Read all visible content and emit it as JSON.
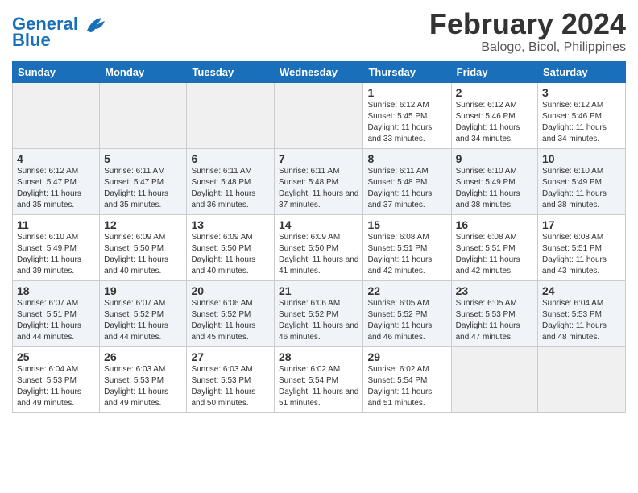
{
  "header": {
    "logo_line1": "General",
    "logo_line2": "Blue",
    "month_title": "February 2024",
    "location": "Balogo, Bicol, Philippines"
  },
  "days_of_week": [
    "Sunday",
    "Monday",
    "Tuesday",
    "Wednesday",
    "Thursday",
    "Friday",
    "Saturday"
  ],
  "weeks": [
    [
      {
        "day": "",
        "sunrise": "",
        "sunset": "",
        "daylight": ""
      },
      {
        "day": "",
        "sunrise": "",
        "sunset": "",
        "daylight": ""
      },
      {
        "day": "",
        "sunrise": "",
        "sunset": "",
        "daylight": ""
      },
      {
        "day": "",
        "sunrise": "",
        "sunset": "",
        "daylight": ""
      },
      {
        "day": "1",
        "sunrise": "6:12 AM",
        "sunset": "5:45 PM",
        "daylight": "11 hours and 33 minutes."
      },
      {
        "day": "2",
        "sunrise": "6:12 AM",
        "sunset": "5:46 PM",
        "daylight": "11 hours and 34 minutes."
      },
      {
        "day": "3",
        "sunrise": "6:12 AM",
        "sunset": "5:46 PM",
        "daylight": "11 hours and 34 minutes."
      }
    ],
    [
      {
        "day": "4",
        "sunrise": "6:12 AM",
        "sunset": "5:47 PM",
        "daylight": "11 hours and 35 minutes."
      },
      {
        "day": "5",
        "sunrise": "6:11 AM",
        "sunset": "5:47 PM",
        "daylight": "11 hours and 35 minutes."
      },
      {
        "day": "6",
        "sunrise": "6:11 AM",
        "sunset": "5:48 PM",
        "daylight": "11 hours and 36 minutes."
      },
      {
        "day": "7",
        "sunrise": "6:11 AM",
        "sunset": "5:48 PM",
        "daylight": "11 hours and 37 minutes."
      },
      {
        "day": "8",
        "sunrise": "6:11 AM",
        "sunset": "5:48 PM",
        "daylight": "11 hours and 37 minutes."
      },
      {
        "day": "9",
        "sunrise": "6:10 AM",
        "sunset": "5:49 PM",
        "daylight": "11 hours and 38 minutes."
      },
      {
        "day": "10",
        "sunrise": "6:10 AM",
        "sunset": "5:49 PM",
        "daylight": "11 hours and 38 minutes."
      }
    ],
    [
      {
        "day": "11",
        "sunrise": "6:10 AM",
        "sunset": "5:49 PM",
        "daylight": "11 hours and 39 minutes."
      },
      {
        "day": "12",
        "sunrise": "6:09 AM",
        "sunset": "5:50 PM",
        "daylight": "11 hours and 40 minutes."
      },
      {
        "day": "13",
        "sunrise": "6:09 AM",
        "sunset": "5:50 PM",
        "daylight": "11 hours and 40 minutes."
      },
      {
        "day": "14",
        "sunrise": "6:09 AM",
        "sunset": "5:50 PM",
        "daylight": "11 hours and 41 minutes."
      },
      {
        "day": "15",
        "sunrise": "6:08 AM",
        "sunset": "5:51 PM",
        "daylight": "11 hours and 42 minutes."
      },
      {
        "day": "16",
        "sunrise": "6:08 AM",
        "sunset": "5:51 PM",
        "daylight": "11 hours and 42 minutes."
      },
      {
        "day": "17",
        "sunrise": "6:08 AM",
        "sunset": "5:51 PM",
        "daylight": "11 hours and 43 minutes."
      }
    ],
    [
      {
        "day": "18",
        "sunrise": "6:07 AM",
        "sunset": "5:51 PM",
        "daylight": "11 hours and 44 minutes."
      },
      {
        "day": "19",
        "sunrise": "6:07 AM",
        "sunset": "5:52 PM",
        "daylight": "11 hours and 44 minutes."
      },
      {
        "day": "20",
        "sunrise": "6:06 AM",
        "sunset": "5:52 PM",
        "daylight": "11 hours and 45 minutes."
      },
      {
        "day": "21",
        "sunrise": "6:06 AM",
        "sunset": "5:52 PM",
        "daylight": "11 hours and 46 minutes."
      },
      {
        "day": "22",
        "sunrise": "6:05 AM",
        "sunset": "5:52 PM",
        "daylight": "11 hours and 46 minutes."
      },
      {
        "day": "23",
        "sunrise": "6:05 AM",
        "sunset": "5:53 PM",
        "daylight": "11 hours and 47 minutes."
      },
      {
        "day": "24",
        "sunrise": "6:04 AM",
        "sunset": "5:53 PM",
        "daylight": "11 hours and 48 minutes."
      }
    ],
    [
      {
        "day": "25",
        "sunrise": "6:04 AM",
        "sunset": "5:53 PM",
        "daylight": "11 hours and 49 minutes."
      },
      {
        "day": "26",
        "sunrise": "6:03 AM",
        "sunset": "5:53 PM",
        "daylight": "11 hours and 49 minutes."
      },
      {
        "day": "27",
        "sunrise": "6:03 AM",
        "sunset": "5:53 PM",
        "daylight": "11 hours and 50 minutes."
      },
      {
        "day": "28",
        "sunrise": "6:02 AM",
        "sunset": "5:54 PM",
        "daylight": "11 hours and 51 minutes."
      },
      {
        "day": "29",
        "sunrise": "6:02 AM",
        "sunset": "5:54 PM",
        "daylight": "11 hours and 51 minutes."
      },
      {
        "day": "",
        "sunrise": "",
        "sunset": "",
        "daylight": ""
      },
      {
        "day": "",
        "sunrise": "",
        "sunset": "",
        "daylight": ""
      }
    ]
  ]
}
